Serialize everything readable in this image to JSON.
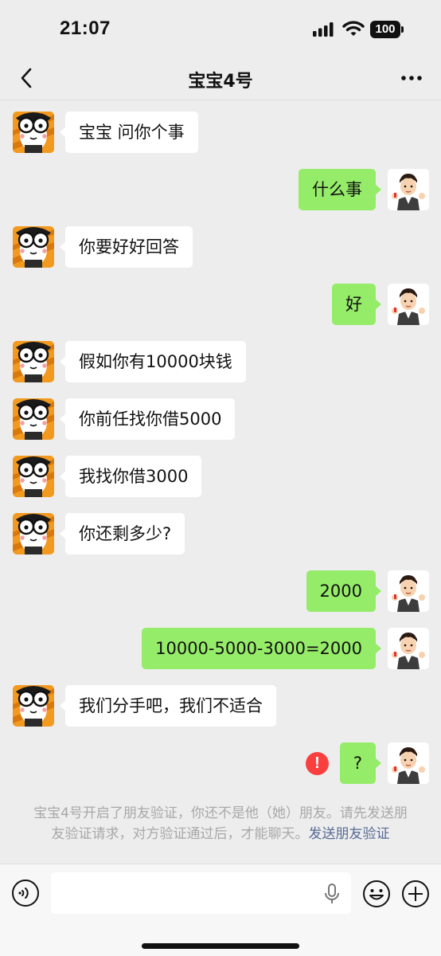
{
  "status": {
    "time": "21:07",
    "battery": "100"
  },
  "header": {
    "title": "宝宝4号"
  },
  "messages": [
    {
      "side": "in",
      "text": "宝宝 问你个事"
    },
    {
      "side": "out",
      "text": "什么事"
    },
    {
      "side": "in",
      "text": "你要好好回答"
    },
    {
      "side": "out",
      "text": "好"
    },
    {
      "side": "in",
      "text": "假如你有10000块钱"
    },
    {
      "side": "in",
      "text": "你前任找你借5000"
    },
    {
      "side": "in",
      "text": "我找你借3000"
    },
    {
      "side": "in",
      "text": "你还剩多少?"
    },
    {
      "side": "out",
      "text": "2000"
    },
    {
      "side": "out",
      "text": "10000-5000-3000=2000"
    },
    {
      "side": "in",
      "text": "我们分手吧，我们不适合"
    },
    {
      "side": "out",
      "text": "?",
      "failed": true,
      "error_mark": "!"
    }
  ],
  "notice": {
    "text": "宝宝4号开启了朋友验证，你还不是他（她）朋友。请先发送朋友验证请求，对方验证通过后，才能聊天。",
    "link": "发送朋友验证"
  },
  "input": {
    "value": ""
  },
  "colors": {
    "outgoing_bubble": "#95ec69",
    "incoming_bubble": "#ffffff",
    "link": "#576b95",
    "error": "#fa3f3f"
  }
}
